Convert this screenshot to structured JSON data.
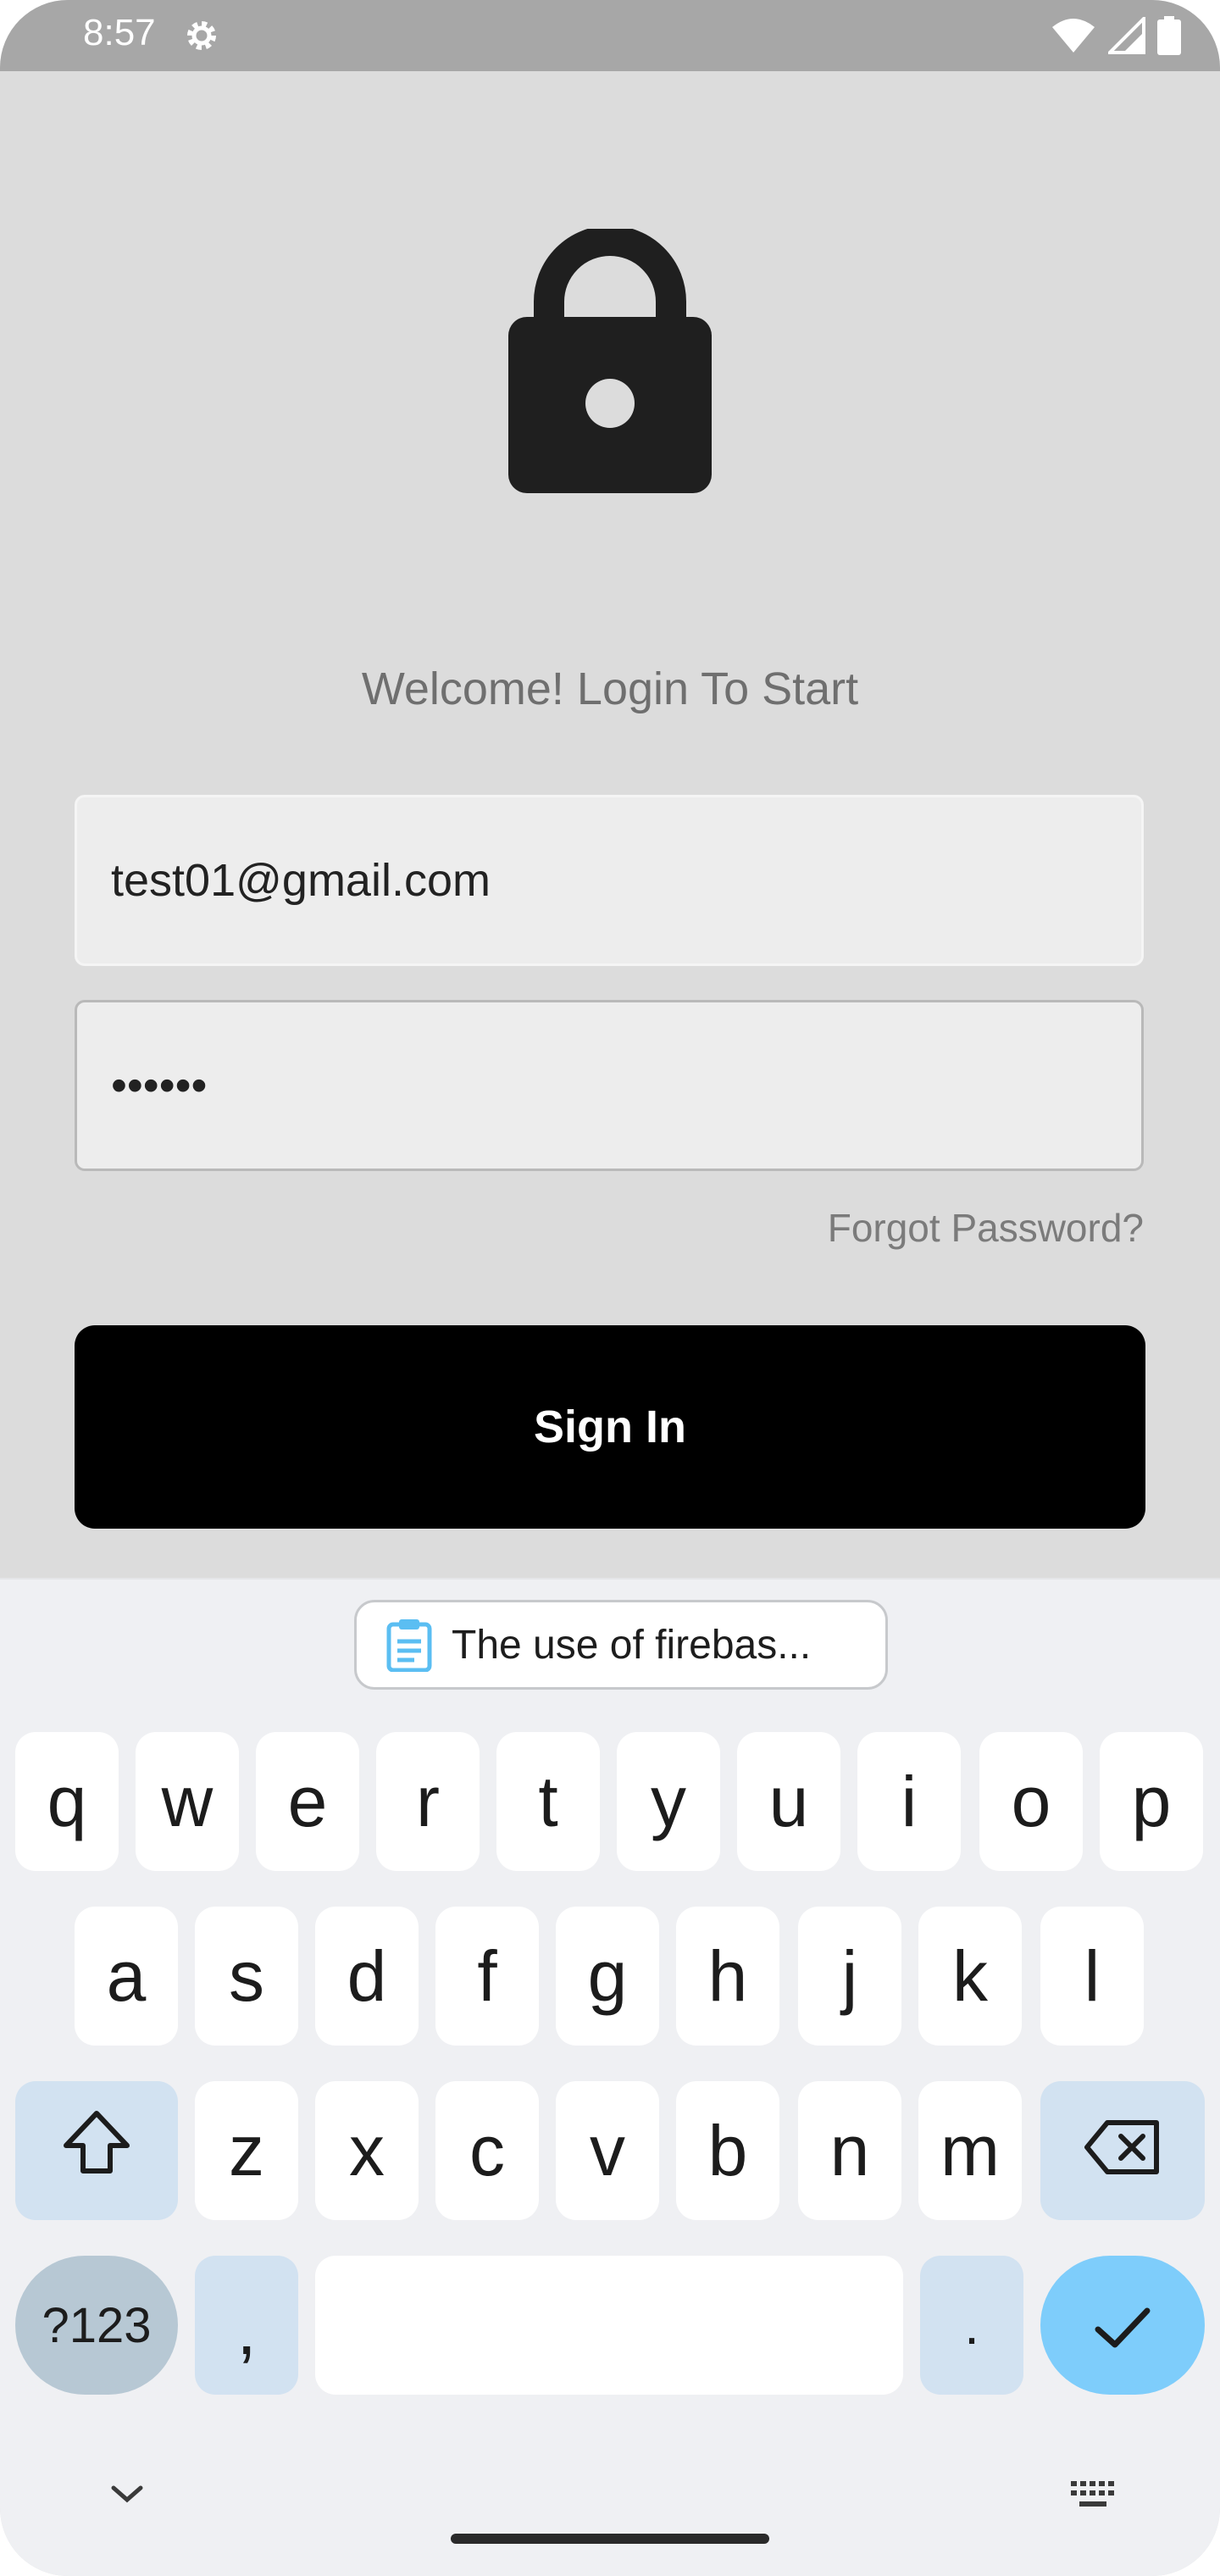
{
  "status_bar": {
    "time": "8:57",
    "icons": [
      "gear-icon",
      "wifi-icon",
      "signal-icon",
      "battery-icon"
    ]
  },
  "app": {
    "logo_icon": "lock-icon",
    "welcome_text": "Welcome! Login To Start",
    "email_value": "test01@gmail.com",
    "password_value": "••••••",
    "forgot_label": "Forgot Password?",
    "signin_label": "Sign In"
  },
  "keyboard": {
    "clipboard_suggestion": "The use of firebas...",
    "row1": [
      "q",
      "w",
      "e",
      "r",
      "t",
      "y",
      "u",
      "i",
      "o",
      "p"
    ],
    "row2": [
      "a",
      "s",
      "d",
      "f",
      "g",
      "h",
      "j",
      "k",
      "l"
    ],
    "row3": [
      "z",
      "x",
      "c",
      "v",
      "b",
      "n",
      "m"
    ],
    "symbols_label": "?123",
    "comma_label": ",",
    "period_label": ".",
    "special_icons": [
      "shift-icon",
      "backspace-icon",
      "checkmark-icon",
      "chevron-down-icon",
      "keyboard-icon"
    ]
  },
  "colors": {
    "status_bar_bg": "#a7a7a7",
    "app_bg": "#dcdcdc",
    "button_bg": "#000000",
    "keyboard_bg": "#eff0f3",
    "enter_key": "#7ecdfb",
    "modifier_key": "#d2e2f1"
  }
}
